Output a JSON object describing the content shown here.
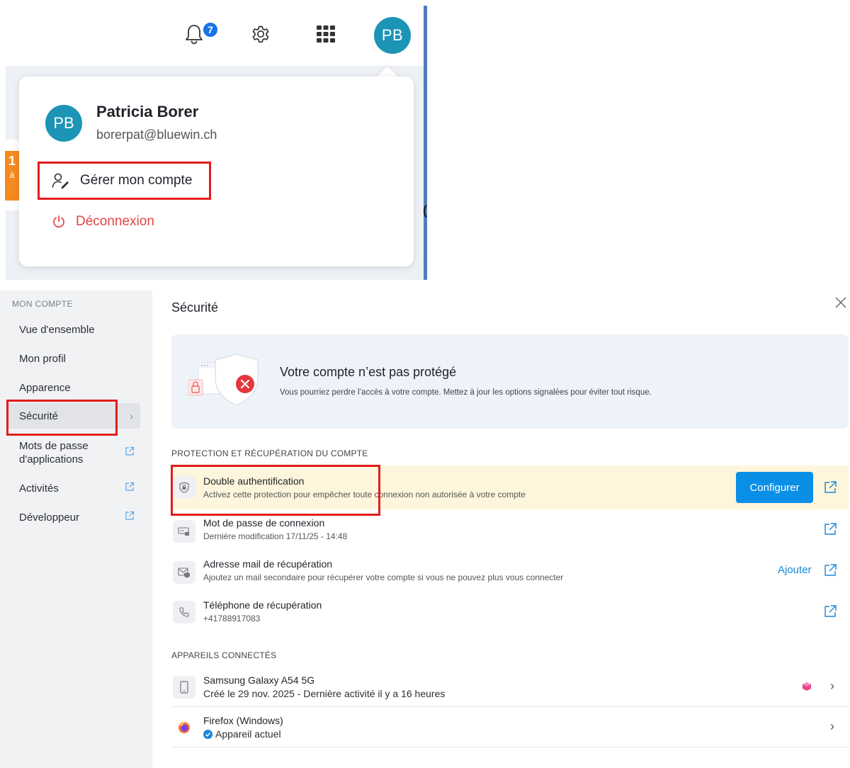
{
  "topbar": {
    "notification_count": "7",
    "avatar_initials": "PB"
  },
  "background": {
    "orange_tab_num": "1",
    "orange_tab_letter": "à",
    "stray_char": "("
  },
  "popup": {
    "avatar_initials": "PB",
    "user_name": "Patricia Borer",
    "user_email": "borerpat@bluewin.ch",
    "manage_account_label": "Gérer mon compte",
    "logout_label": "Déconnexion"
  },
  "sidebar": {
    "heading": "MON COMPTE",
    "items": [
      {
        "label": "Vue d'ensemble"
      },
      {
        "label": "Mon profil"
      },
      {
        "label": "Apparence"
      },
      {
        "label": "Sécurité"
      },
      {
        "label": "Mots de passe d'applications"
      },
      {
        "label": "Activités"
      },
      {
        "label": "Développeur"
      }
    ]
  },
  "main": {
    "title": "Sécurité",
    "banner": {
      "title": "Votre compte n’est pas protégé",
      "subtitle": "Vous pourriez perdre l’accès à votre compte. Mettez à jour les options signalées pour éviter tout risque."
    },
    "protection_heading": "PROTECTION ET RÉCUPÉRATION DU COMPTE",
    "protection_rows": [
      {
        "title": "Double authentification",
        "subtitle": "Activez cette protection pour empêcher toute connexion non autorisée à votre compte",
        "action": "Configurer"
      },
      {
        "title": "Mot de passe de connexion",
        "subtitle": "Dernière modification 17/11/25 - 14:48"
      },
      {
        "title": "Adresse mail de récupération",
        "subtitle": "Ajoutez un mail secondaire pour récupérer votre compte si vous ne pouvez plus vous connecter",
        "action": "Ajouter"
      },
      {
        "title": "Téléphone de récupération",
        "subtitle": "+41788917083"
      }
    ],
    "devices_heading": "APPAREILS CONNECTÉS",
    "devices": [
      {
        "name": "Samsung Galaxy A54 5G",
        "detail": "Créé le 29 nov. 2025 - Dernière activité il y a 16 heures"
      },
      {
        "name": "Firefox (Windows)",
        "detail": "Appareil actuel"
      }
    ]
  },
  "colors": {
    "accent": "#0a8fe6",
    "avatar": "#1b94b5",
    "highlight_box": "#e31c1c",
    "logout": "#e54343",
    "warning_row": "#fdf6dc"
  }
}
